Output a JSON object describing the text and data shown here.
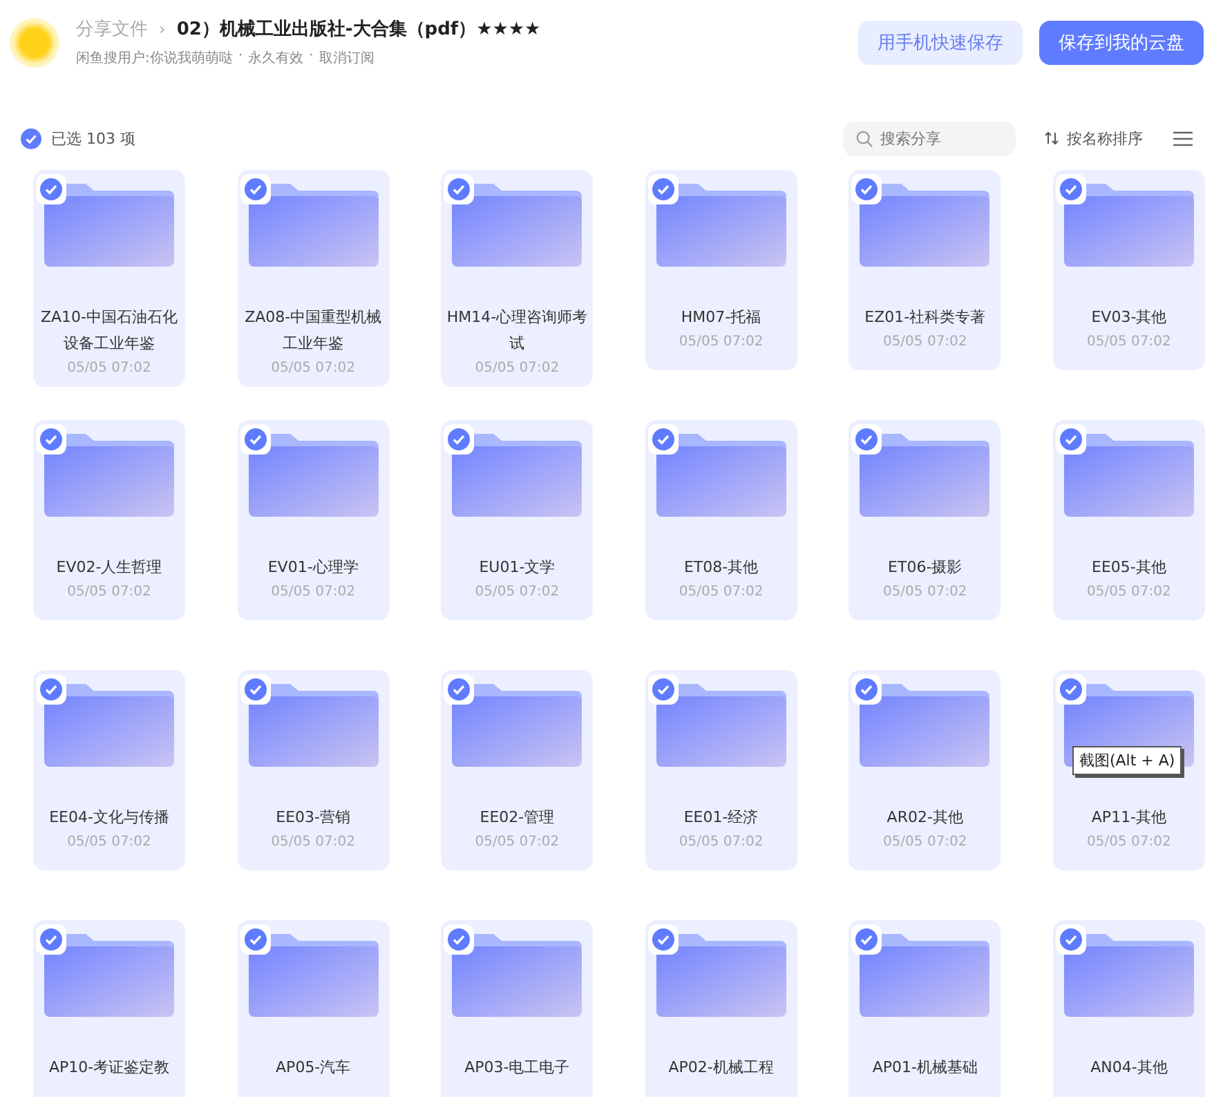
{
  "header": {
    "breadcrumb_root": "分享文件",
    "separator": "›",
    "title": "02）机械工业出版社-大合集（pdf）★★★★",
    "sharer": "闲鱼搜用户:你说我萌萌哒",
    "dot": "·",
    "validity": "永久有效",
    "unsubscribe": "取消订阅",
    "buttons": [
      {
        "label": "用手机快速保存",
        "kind": "secondary"
      },
      {
        "label": "保存到我的云盘",
        "kind": "primary"
      }
    ]
  },
  "toolbar": {
    "select_all": {
      "checked": true,
      "label": "已选 103 项"
    },
    "search": {
      "placeholder": "搜索分享"
    },
    "sort": {
      "label": "按名称排序"
    }
  },
  "folders": [
    {
      "name": "ZA10-中国石油石化设备工业年鉴",
      "date": "05/05 07:02",
      "selected": true
    },
    {
      "name": "ZA08-中国重型机械工业年鉴",
      "date": "05/05 07:02",
      "selected": true
    },
    {
      "name": "HM14-心理咨询师考试",
      "date": "05/05 07:02",
      "selected": true
    },
    {
      "name": "HM07-托福",
      "date": "05/05 07:02",
      "selected": true
    },
    {
      "name": "EZ01-社科类专著",
      "date": "05/05 07:02",
      "selected": true
    },
    {
      "name": "EV03-其他",
      "date": "05/05 07:02",
      "selected": true
    },
    {
      "name": "EV02-人生哲理",
      "date": "05/05 07:02",
      "selected": true
    },
    {
      "name": "EV01-心理学",
      "date": "05/05 07:02",
      "selected": true
    },
    {
      "name": "EU01-文学",
      "date": "05/05 07:02",
      "selected": true
    },
    {
      "name": "ET08-其他",
      "date": "05/05 07:02",
      "selected": true
    },
    {
      "name": "ET06-摄影",
      "date": "05/05 07:02",
      "selected": true
    },
    {
      "name": "EE05-其他",
      "date": "05/05 07:02",
      "selected": true
    },
    {
      "name": "EE04-文化与传播",
      "date": "05/05 07:02",
      "selected": true
    },
    {
      "name": "EE03-营销",
      "date": "05/05 07:02",
      "selected": true
    },
    {
      "name": "EE02-管理",
      "date": "05/05 07:02",
      "selected": true
    },
    {
      "name": "EE01-经济",
      "date": "05/05 07:02",
      "selected": true
    },
    {
      "name": "AR02-其他",
      "date": "05/05 07:02",
      "selected": true
    },
    {
      "name": "AP11-其他",
      "date": "05/05 07:02",
      "selected": true,
      "tooltip": "截图(Alt + A)"
    },
    {
      "name": "AP10-考证鉴定教",
      "selected": true
    },
    {
      "name": "AP05-汽车",
      "selected": true
    },
    {
      "name": "AP03-电工电子",
      "selected": true
    },
    {
      "name": "AP02-机械工程",
      "selected": true
    },
    {
      "name": "AP01-机械基础",
      "selected": true
    },
    {
      "name": "AN04-其他",
      "selected": true
    }
  ]
}
